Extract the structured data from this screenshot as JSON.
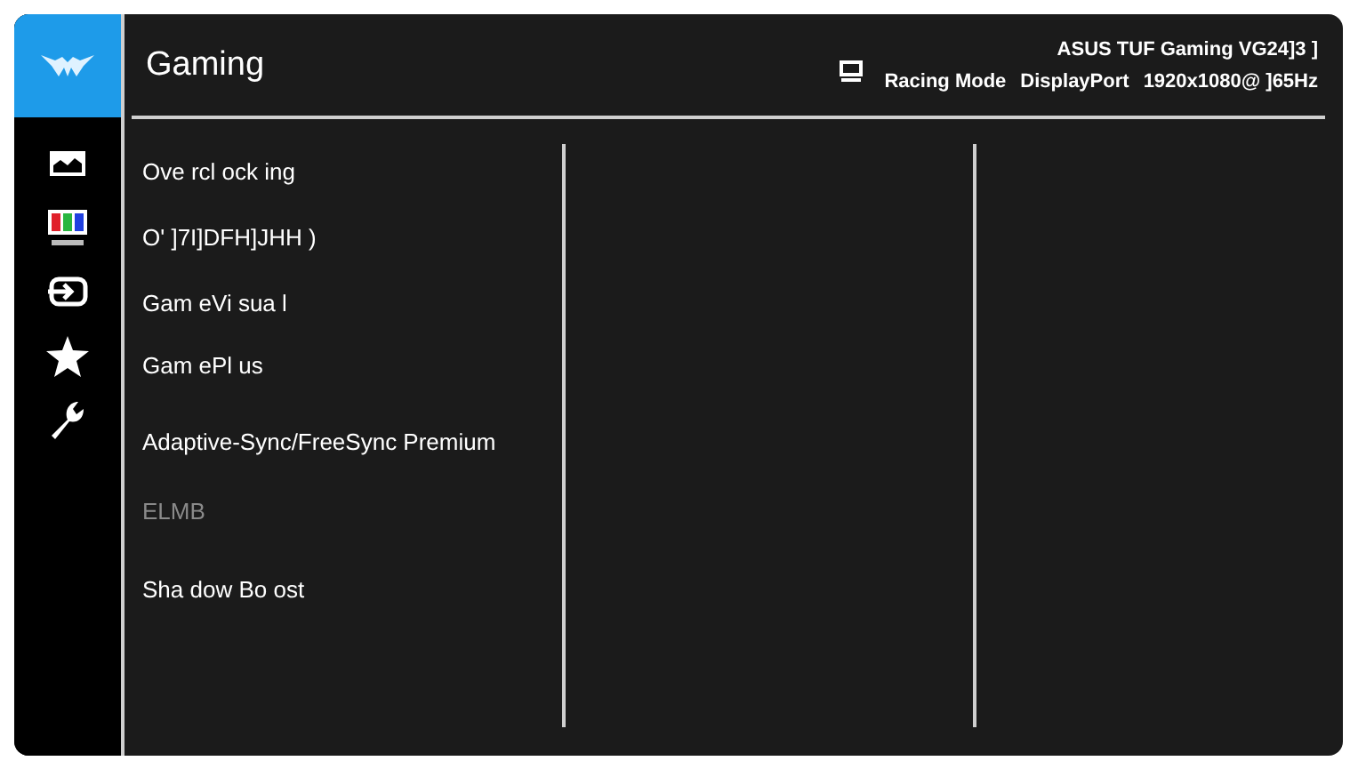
{
  "sidebar": {
    "items": [
      {
        "kind": "logo",
        "selected": true
      },
      {
        "kind": "image",
        "selected": false
      },
      {
        "kind": "color",
        "selected": false
      },
      {
        "kind": "input",
        "selected": false
      },
      {
        "kind": "star",
        "selected": false
      },
      {
        "kind": "wrench",
        "selected": false
      }
    ]
  },
  "header": {
    "title": "Gaming",
    "model": "ASUS TUF Gaming  VG24]3 ]",
    "mode": "Racing Mode",
    "input": "DisplayPort",
    "resolution": "1920x1080@ ]65Hz"
  },
  "menu": {
    "items": [
      {
        "label": "Ove rcl ock ing",
        "disabled": false
      },
      {
        "label": "O'  ]7I]DFH]JHH )",
        "disabled": false
      },
      {
        "label": "Gam eVi sua l",
        "disabled": false
      },
      {
        "label": "Gam ePl us",
        "disabled": false
      },
      {
        "label": "Adaptive-Sync/FreeSync Premium",
        "disabled": false
      },
      {
        "label": "ELMB",
        "disabled": true
      },
      {
        "label": "Sha dow  Bo ost",
        "disabled": false
      }
    ]
  }
}
